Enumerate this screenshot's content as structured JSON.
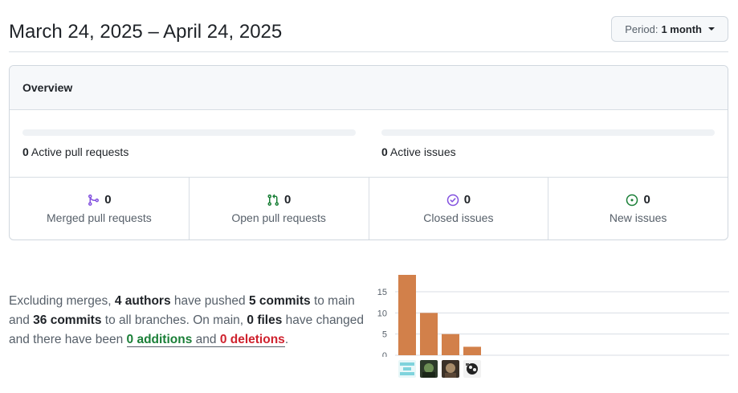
{
  "header": {
    "date_range": "March 24, 2025 – April 24, 2025",
    "period_label": "Period:",
    "period_value": "1 month"
  },
  "overview": {
    "title": "Overview",
    "active_pr_count": "0",
    "active_pr_label": "Active pull requests",
    "active_issues_count": "0",
    "active_issues_label": "Active issues",
    "stats": [
      {
        "count": "0",
        "label": "Merged pull requests",
        "icon": "git-merge-icon",
        "color": "#8250df"
      },
      {
        "count": "0",
        "label": "Open pull requests",
        "icon": "git-pull-request-icon",
        "color": "#1a7f37"
      },
      {
        "count": "0",
        "label": "Closed issues",
        "icon": "issue-closed-icon",
        "color": "#8250df"
      },
      {
        "count": "0",
        "label": "New issues",
        "icon": "issue-opened-icon",
        "color": "#1a7f37"
      }
    ]
  },
  "commits": {
    "p1": "Excluding merges, ",
    "authors": "4 authors",
    "p2": " have pushed ",
    "commits_main": "5 commits",
    "p3": " to main and ",
    "commits_all": "36 commits",
    "p4": " to all branches. On main, ",
    "files": "0 files",
    "p5": " have changed and there have been ",
    "additions_num": "0",
    "additions_word": " additions",
    "and_word": " and ",
    "deletions_num": "0",
    "deletions_word": " deletions",
    "end": "."
  },
  "chart_data": {
    "type": "bar",
    "categories": [
      "author-1",
      "author-2",
      "author-3",
      "author-4"
    ],
    "values": [
      19,
      10,
      5,
      2
    ],
    "ylim": [
      0,
      19
    ],
    "yticks": [
      0,
      5,
      10,
      15
    ],
    "bar_color": "#d2804a",
    "grid": true
  }
}
